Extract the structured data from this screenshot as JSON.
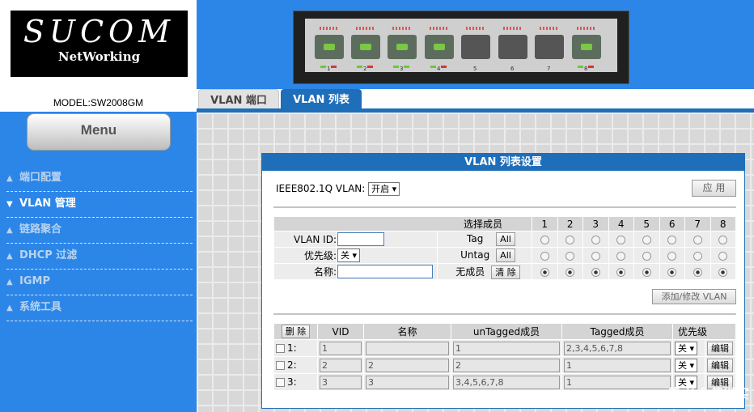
{
  "logo": {
    "main": "SUCOM",
    "sub": "NetWorking"
  },
  "model": "MODEL:SW2008GM",
  "switch_ports": [
    "1",
    "2",
    "3",
    "4",
    "5",
    "6",
    "7",
    "8"
  ],
  "tabs": [
    {
      "label": "VLAN 端口"
    },
    {
      "label": "VLAN 列表"
    }
  ],
  "menu_label": "Menu",
  "nav": [
    {
      "label": "端口配置",
      "arrow": "▲",
      "active": false
    },
    {
      "label": "VLAN 管理",
      "arrow": "▼",
      "active": true
    },
    {
      "label": "链路聚合",
      "arrow": "▲",
      "active": false
    },
    {
      "label": "DHCP 过滤",
      "arrow": "▲",
      "active": false
    },
    {
      "label": "IGMP",
      "arrow": "▲",
      "active": false
    },
    {
      "label": "系统工具",
      "arrow": "▲",
      "active": false
    }
  ],
  "panel": {
    "title": "VLAN 列表设置",
    "ieee_label": "IEEE802.1Q VLAN:",
    "ieee_value": "开启",
    "apply_label": "应 用",
    "members_header": "选择成员",
    "port_numbers": [
      "1",
      "2",
      "3",
      "4",
      "5",
      "6",
      "7",
      "8"
    ],
    "vlan_id_label": "VLAN ID:",
    "priority_label": "优先级:",
    "priority_value": "关",
    "name_label": "名称:",
    "tag_label": "Tag",
    "untag_label": "Untag",
    "none_label": "无成员",
    "all_label": "All",
    "clear_label": "清 除",
    "add_label": "添加/修改 VLAN"
  },
  "list": {
    "delete_label": "删 除",
    "headers": [
      "VID",
      "名称",
      "unTagged成员",
      "Tagged成员",
      "优先级"
    ],
    "rows": [
      {
        "index": "1:",
        "vid": "1",
        "name": "",
        "untagged": "1",
        "tagged": "2,3,4,5,6,7,8",
        "priority": "关",
        "edit": "编辑"
      },
      {
        "index": "2:",
        "vid": "2",
        "name": "2",
        "untagged": "2",
        "tagged": "1",
        "priority": "关",
        "edit": "编辑"
      },
      {
        "index": "3:",
        "vid": "3",
        "name": "3",
        "untagged": "3,4,5,6,7,8",
        "tagged": "1",
        "priority": "关",
        "edit": "编辑"
      }
    ]
  },
  "watermark": "值 什么值得买"
}
